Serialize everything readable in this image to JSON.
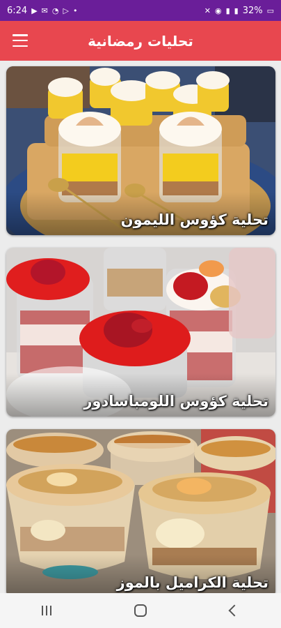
{
  "status_bar": {
    "time": "6:24",
    "battery": "32%",
    "left_icons": [
      "youtube-icon",
      "mail-icon",
      "chat-icon",
      "play-icon",
      "dot-icon"
    ],
    "right_icons": [
      "mute-icon",
      "hotspot-icon",
      "volte-icon",
      "signal-icon",
      "signal-icon",
      "battery-icon"
    ]
  },
  "app_bar": {
    "title": "تحليات رمضانية",
    "menu_icon": "hamburger-menu-icon"
  },
  "recipes": [
    {
      "title": "تحلية كؤوس الليمون"
    },
    {
      "title": "تحلية كؤوس اللومباسادور"
    },
    {
      "title": "تحلية الكراميل بالموز"
    }
  ],
  "nav_bar": {
    "buttons": [
      "recents-icon",
      "home-icon",
      "back-icon"
    ]
  },
  "colors": {
    "status_bar": "#6a1e99",
    "app_bar": "#e8474f",
    "background": "#ececec"
  }
}
